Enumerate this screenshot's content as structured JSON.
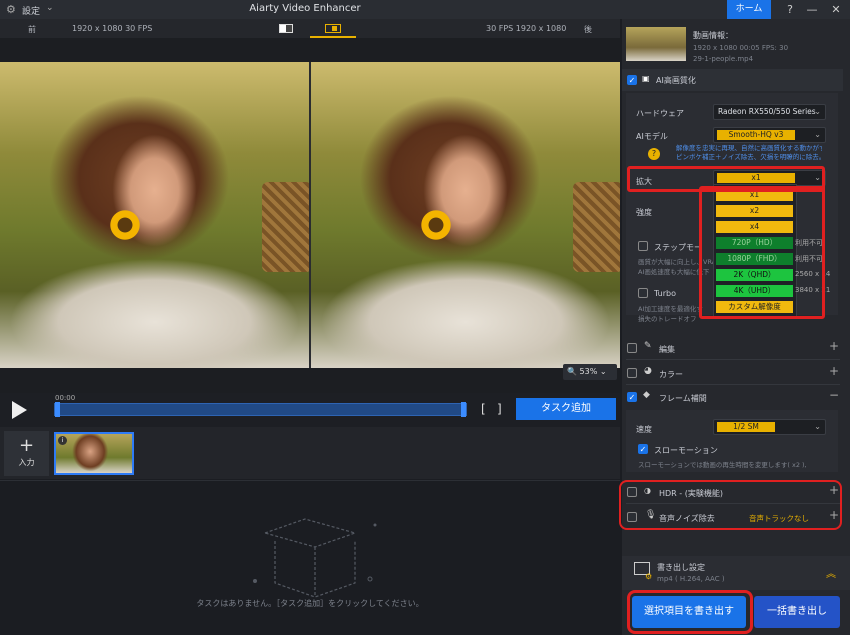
{
  "window": {
    "settings": "設定",
    "title": "Aiarty Video Enhancer",
    "home": "ホーム",
    "help": "?",
    "minimize": "—",
    "maximize": "☐",
    "close": "✕"
  },
  "preview": {
    "before_label": "前",
    "after_label": "後",
    "left_info": "1920 x 1080  30 FPS",
    "right_info": "30 FPS  1920 x 1080",
    "zoom": "53%"
  },
  "timeline": {
    "time": "00:00",
    "bracket_open": "[",
    "bracket_close": "]",
    "task_add": "タスク追加"
  },
  "thumbs": {
    "input_label": "入力",
    "badge": "i"
  },
  "task_area": {
    "empty_message": "タスクはありません。［タスク追加］をクリックしてください。"
  },
  "video_info": {
    "title": "動画情報：",
    "specs": "1920 x 1080   00:05   FPS: 30",
    "filename": "29-1-people.mp4"
  },
  "ai_enhance": {
    "label": "AI高画質化",
    "hardware_label": "ハードウェア",
    "hardware_value": "Radeon RX550/550 Series",
    "model_label": "AIモデル",
    "model_value": "Smooth-HQ v3",
    "model_desc1": "解像度を忠実に再現、自然に高画質化する動かがす。",
    "model_desc2": "ピンボケ補正＋ノイズ除去、欠損を明瞭的に除去。",
    "upscale_label": "拡大",
    "upscale_value": "x1",
    "strength_label": "強度",
    "step_label": "ステップモー",
    "step_desc1": "画質が大幅に向上し、VRA",
    "step_desc2": "AI画処速度も大幅に低下",
    "turbo_label": "Turbo",
    "turbo_desc1": "AI加工速度を最適化す",
    "turbo_desc2": "損失のトレードオフ"
  },
  "upscale_options": [
    "x1",
    "x2",
    "x4",
    "720P（HD）",
    "1080P（FHD）",
    "2K（QHD）",
    "4K（UHD）",
    "カスタム解像度"
  ],
  "upscale_side_text": [
    "利用不可",
    "利用不可",
    "2560 x 14",
    "3840 x 21"
  ],
  "sections": {
    "edit": "編集",
    "color": "カラー",
    "frame_interp": "フレーム補間",
    "speed_label": "速度",
    "speed_value": "1/2 SM",
    "slowmo_label": "スローモーション",
    "slowmo_desc": "スローモーションでは動画の再生時間を変更します( x2 ),",
    "hdr": "HDR - (実験機能)",
    "noise": "音声ノイズ除去",
    "noise_status": "音声トラックなし"
  },
  "export": {
    "settings_label": "書き出し設定",
    "format": "mp4 ( H.264, AAC )",
    "export_selected": "選択項目を書き出す",
    "batch_export": "一括書き出し"
  },
  "colors": {
    "accent": "#1a73e8",
    "highlight": "#e8b100",
    "annotation": "#e02020"
  }
}
